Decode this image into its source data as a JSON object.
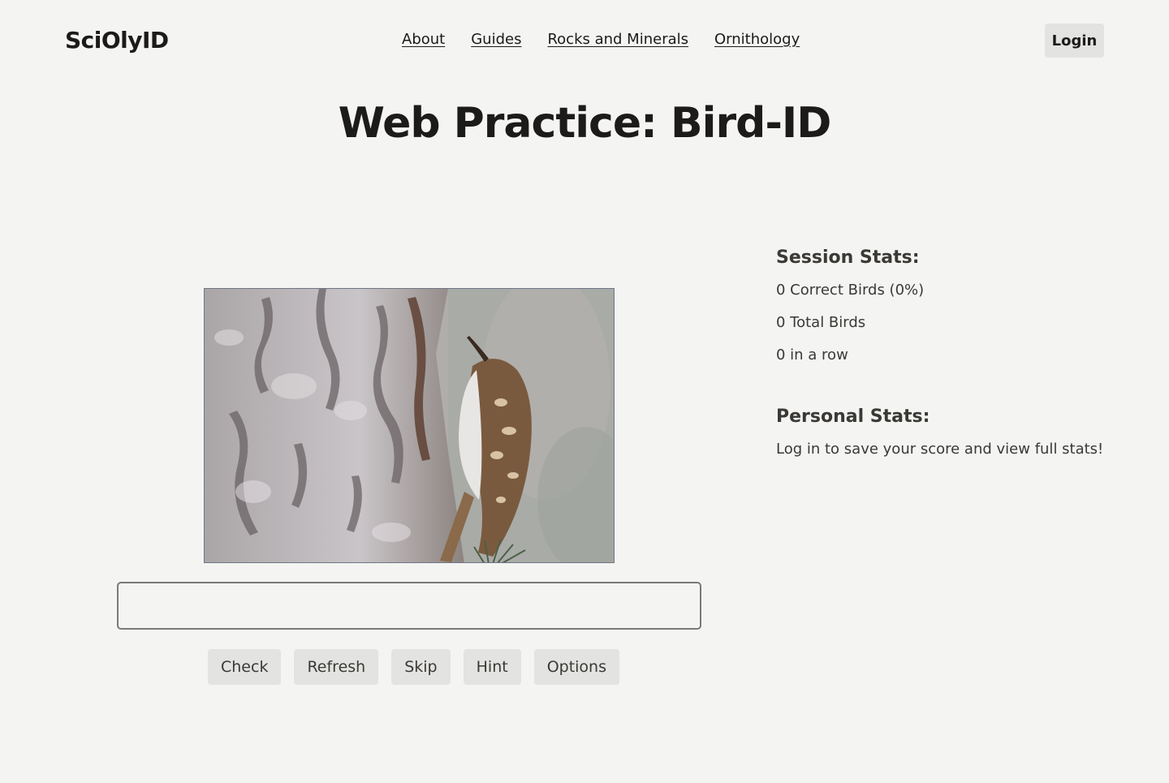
{
  "header": {
    "logo": "SciOlyID",
    "nav": [
      {
        "label": "About"
      },
      {
        "label": "Guides"
      },
      {
        "label": "Rocks and Minerals"
      },
      {
        "label": "Ornithology"
      }
    ],
    "login_label": "Login"
  },
  "main": {
    "title": "Web Practice: Bird-ID",
    "image": {
      "subject": "bird on tree bark"
    },
    "answer_input": {
      "value": "",
      "placeholder": ""
    },
    "buttons": {
      "check": "Check",
      "refresh": "Refresh",
      "skip": "Skip",
      "hint": "Hint",
      "options": "Options"
    }
  },
  "stats": {
    "session_heading": "Session Stats:",
    "correct_birds": "0 Correct Birds (0%)",
    "total_birds": "0 Total Birds",
    "streak": "0 in a row",
    "personal_heading": "Personal Stats:",
    "personal_message": "Log in to save your score and view full stats!"
  }
}
